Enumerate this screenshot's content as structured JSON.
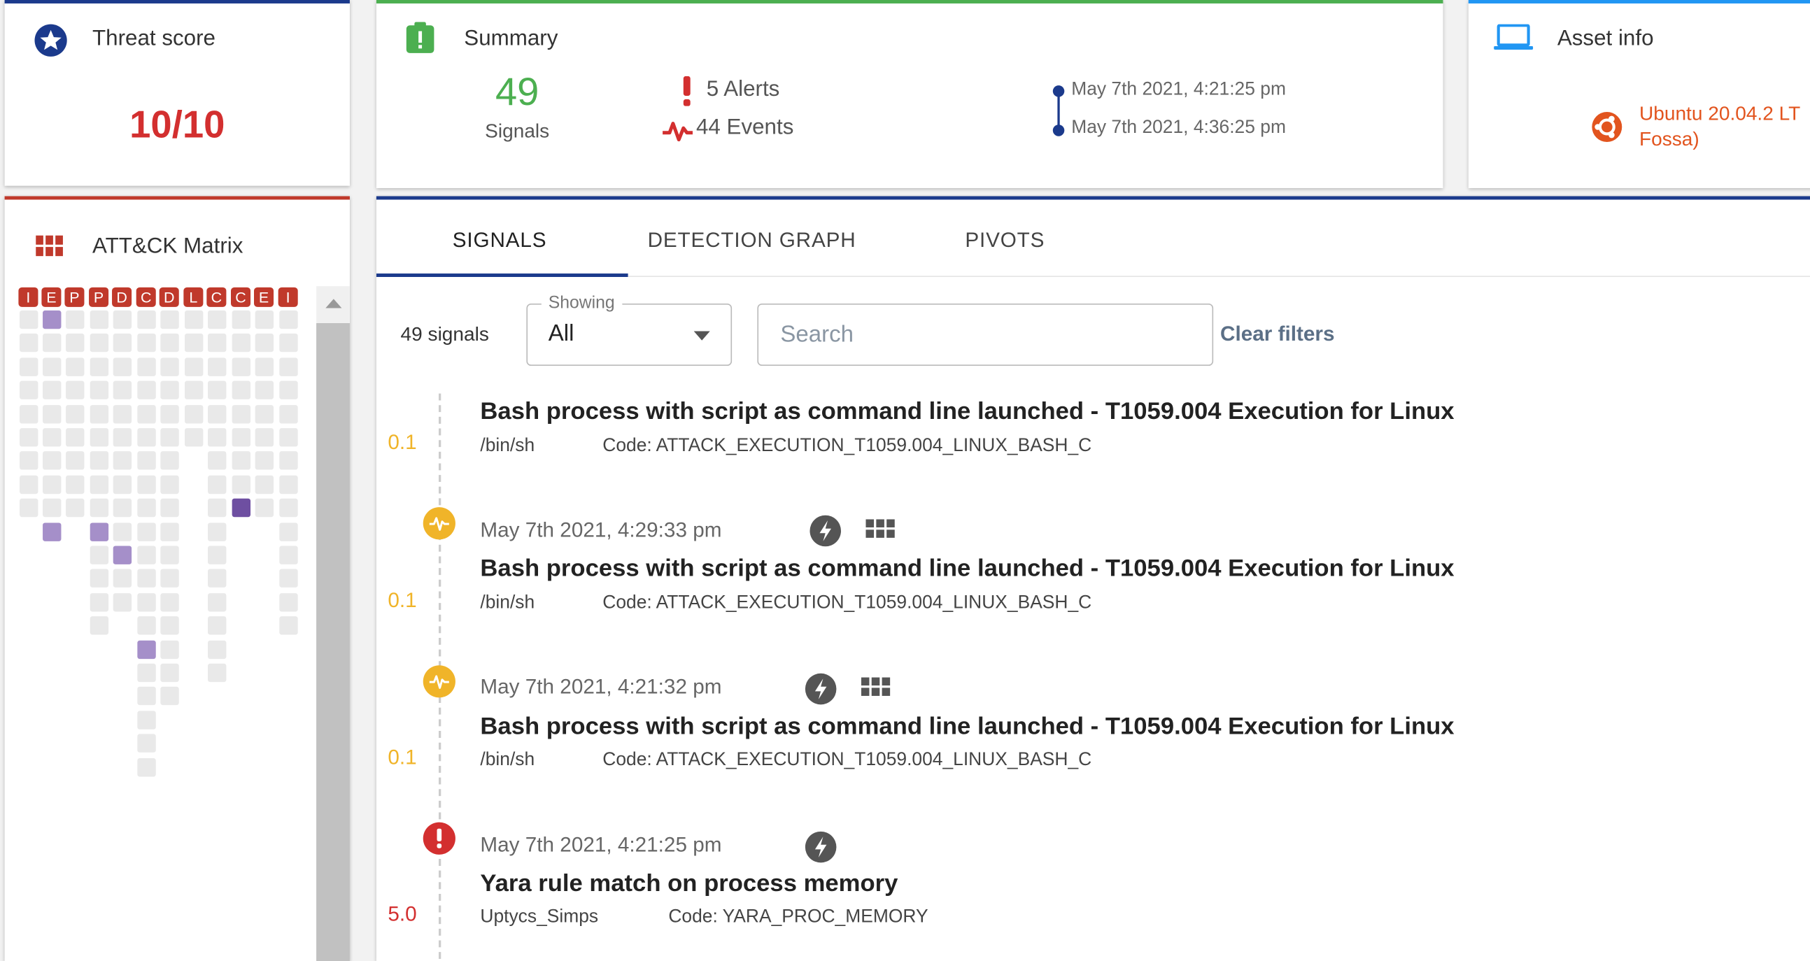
{
  "threat": {
    "title": "Threat score",
    "score": "10/10"
  },
  "summary": {
    "title": "Summary",
    "signals_count": "49",
    "signals_label": "Signals",
    "alerts": "5 Alerts",
    "events": "44 Events",
    "time_start": "May 7th 2021, 4:21:25 pm",
    "time_end": "May 7th 2021, 4:36:25 pm"
  },
  "asset": {
    "title": "Asset info",
    "os_line1": "Ubuntu 20.04.2 LT",
    "os_line2": "Fossa)"
  },
  "matrix": {
    "title": "ATT&CK Matrix",
    "headers": [
      "I",
      "E",
      "P",
      "P",
      "D",
      "C",
      "D",
      "L",
      "C",
      "C",
      "E",
      "I"
    ]
  },
  "tabs": [
    {
      "label": "SIGNALS",
      "active": true
    },
    {
      "label": "DETECTION GRAPH",
      "active": false
    },
    {
      "label": "PIVOTS",
      "active": false
    }
  ],
  "filters": {
    "count": "49 signals",
    "showing_label": "Showing",
    "showing_value": "All",
    "search_placeholder": "Search",
    "clear": "Clear filters"
  },
  "signals": [
    {
      "score": "0.1",
      "title": "Bash process with script as command line launched - T1059.004 Execution for Linux",
      "source": "/bin/sh",
      "code": "Code: ATTACK_EXECUTION_T1059.004_LINUX_BASH_C"
    },
    {
      "date": "May 7th 2021, 4:29:33 pm",
      "score": "0.1",
      "title": "Bash process with script as command line launched - T1059.004 Execution for Linux",
      "source": "/bin/sh",
      "code": "Code: ATTACK_EXECUTION_T1059.004_LINUX_BASH_C"
    },
    {
      "date": "May 7th 2021, 4:21:32 pm",
      "score": "0.1",
      "title": "Bash process with script as command line launched - T1059.004 Execution for Linux",
      "source": "/bin/sh",
      "code": "Code: ATTACK_EXECUTION_T1059.004_LINUX_BASH_C"
    },
    {
      "date": "May 7th 2021, 4:21:25 pm",
      "score": "5.0",
      "title": "Yara rule match on process memory",
      "source": "Uptycs_Simps",
      "code": "Code: YARA_PROC_MEMORY"
    }
  ],
  "colors": {
    "alert_red": "#d32f2f",
    "event_yellow": "#f0b429",
    "signal_green": "#4caf50",
    "os_orange": "#e2541e",
    "link": "#5b6f86"
  }
}
